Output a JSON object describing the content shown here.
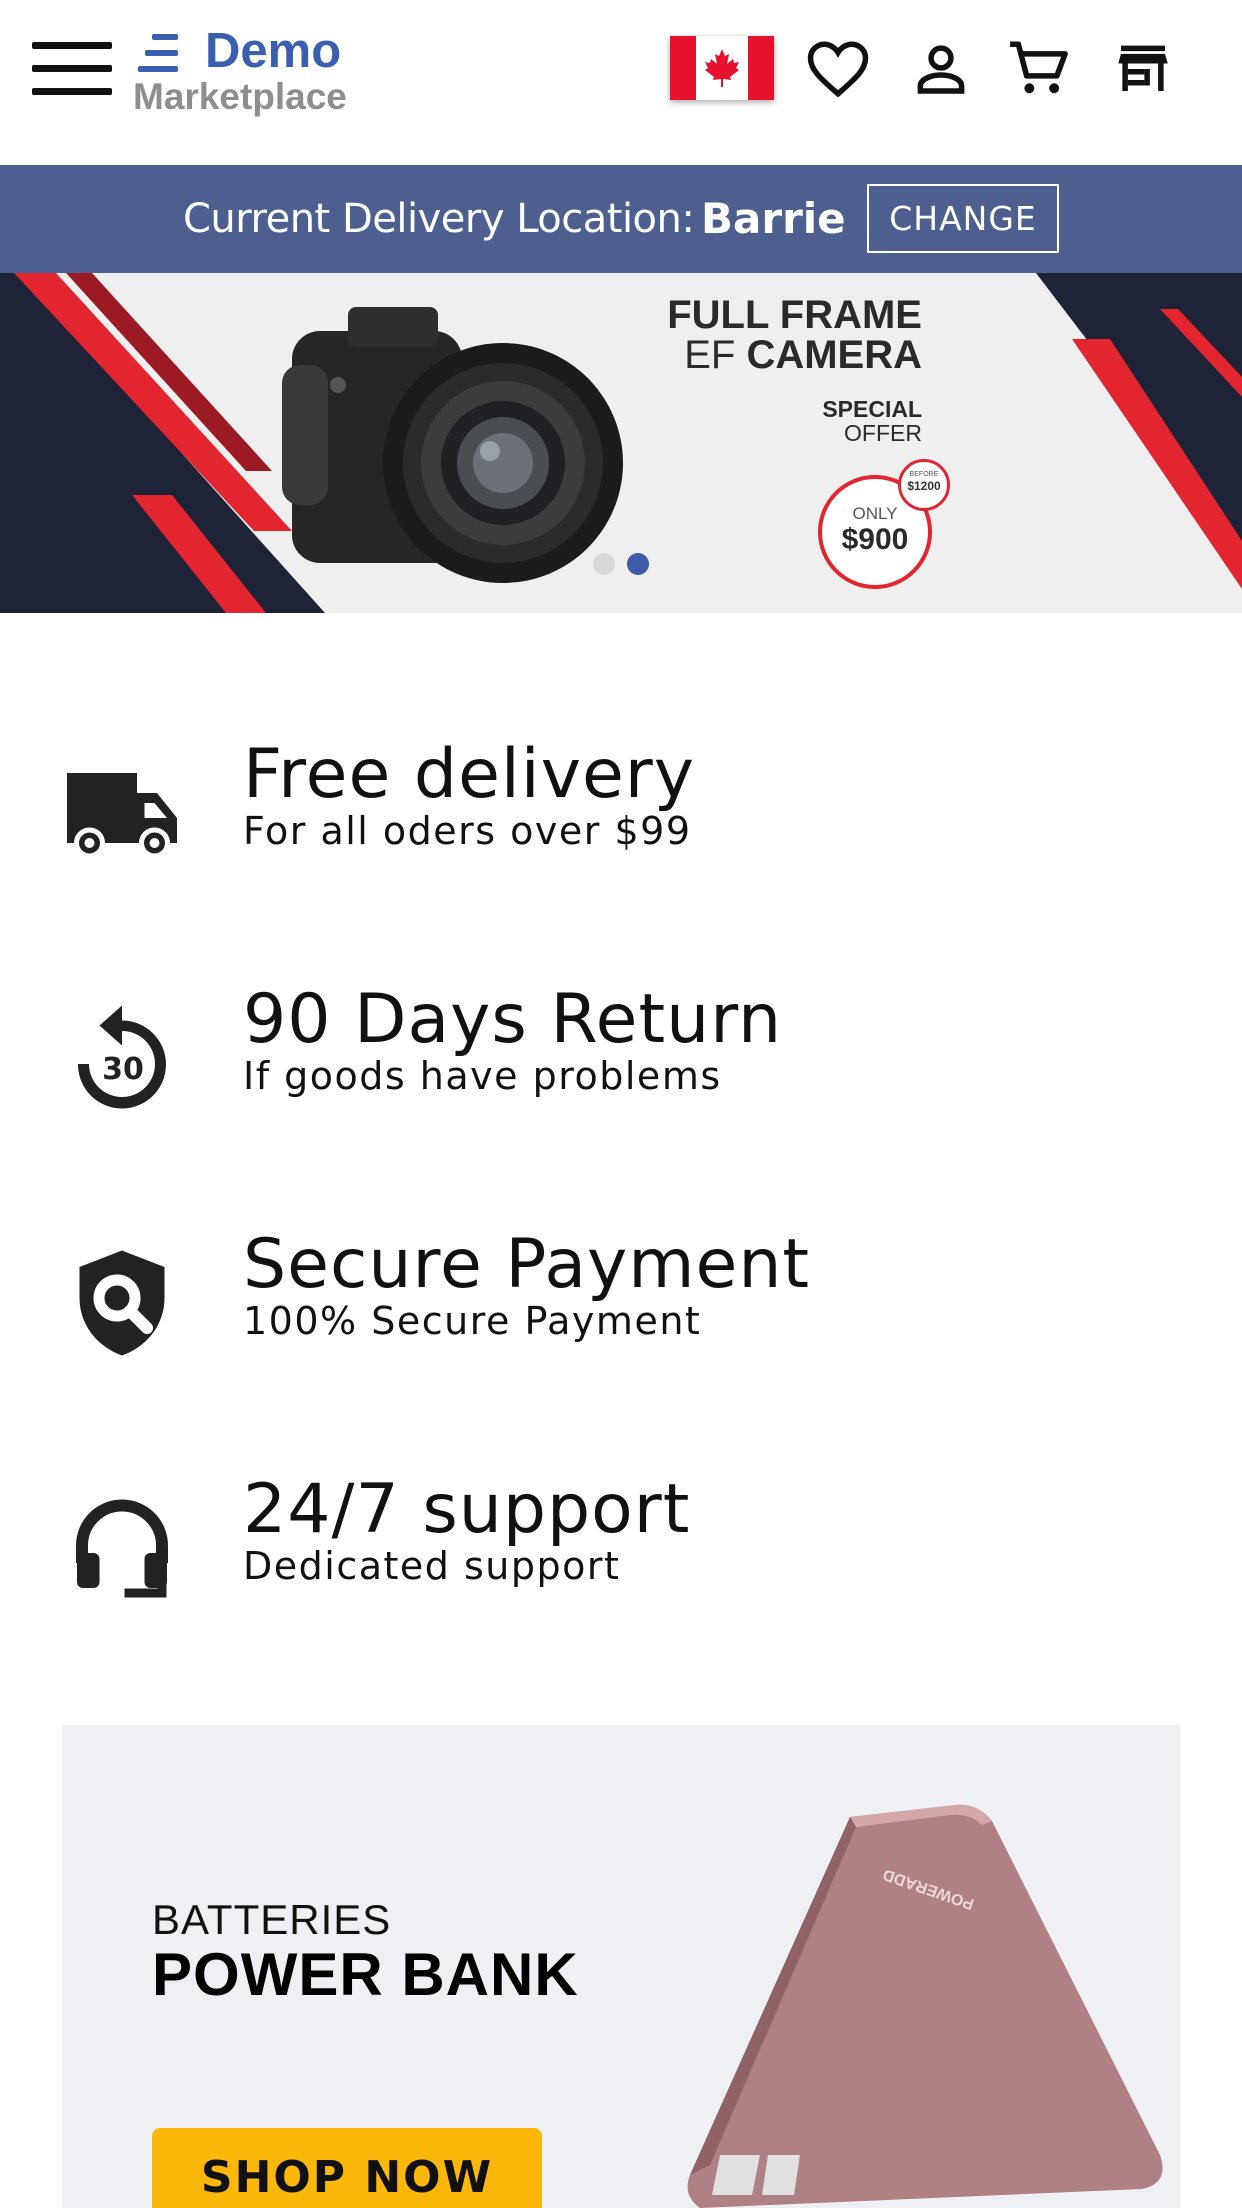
{
  "header": {
    "logo_primary": "Demo",
    "logo_secondary": "Marketplace",
    "icons": [
      "menu-icon",
      "canada-flag-icon",
      "heart-icon",
      "user-icon",
      "cart-icon",
      "store-icon"
    ]
  },
  "location_bar": {
    "label": "Current Delivery Location:",
    "city": "Barrie",
    "change_label": "CHANGE"
  },
  "hero": {
    "title_line1": "FULL FRAME",
    "title_line2_a": "EF",
    "title_line2_b": "CAMERA",
    "special": "SPECIAL",
    "offer": "OFFER",
    "price_prefix": "ONLY",
    "price": "$900",
    "before_label": "BEFORE",
    "before_price": "$1200",
    "active_slide": 2,
    "slide_count": 2
  },
  "features": [
    {
      "title": "Free delivery",
      "subtitle": "For all oders over $99",
      "icon": "truck-icon"
    },
    {
      "title": "90 Days Return",
      "subtitle": "If goods have problems",
      "icon": "replay-30-icon"
    },
    {
      "title": "Secure Payment",
      "subtitle": "100% Secure Payment",
      "icon": "shield-search-icon"
    },
    {
      "title": "24/7 support",
      "subtitle": "Dedicated support",
      "icon": "headset-icon"
    }
  ],
  "promo": {
    "category": "BATTERIES",
    "title": "POWER BANK",
    "button": "SHOP NOW",
    "product_brand": "POWERADD"
  },
  "colors": {
    "brand_blue": "#3a5fb0",
    "location_bar": "#4d5f8e",
    "accent_red": "#e3252f",
    "shop_button": "#fbb80b",
    "dark_navy": "#1e2338"
  }
}
